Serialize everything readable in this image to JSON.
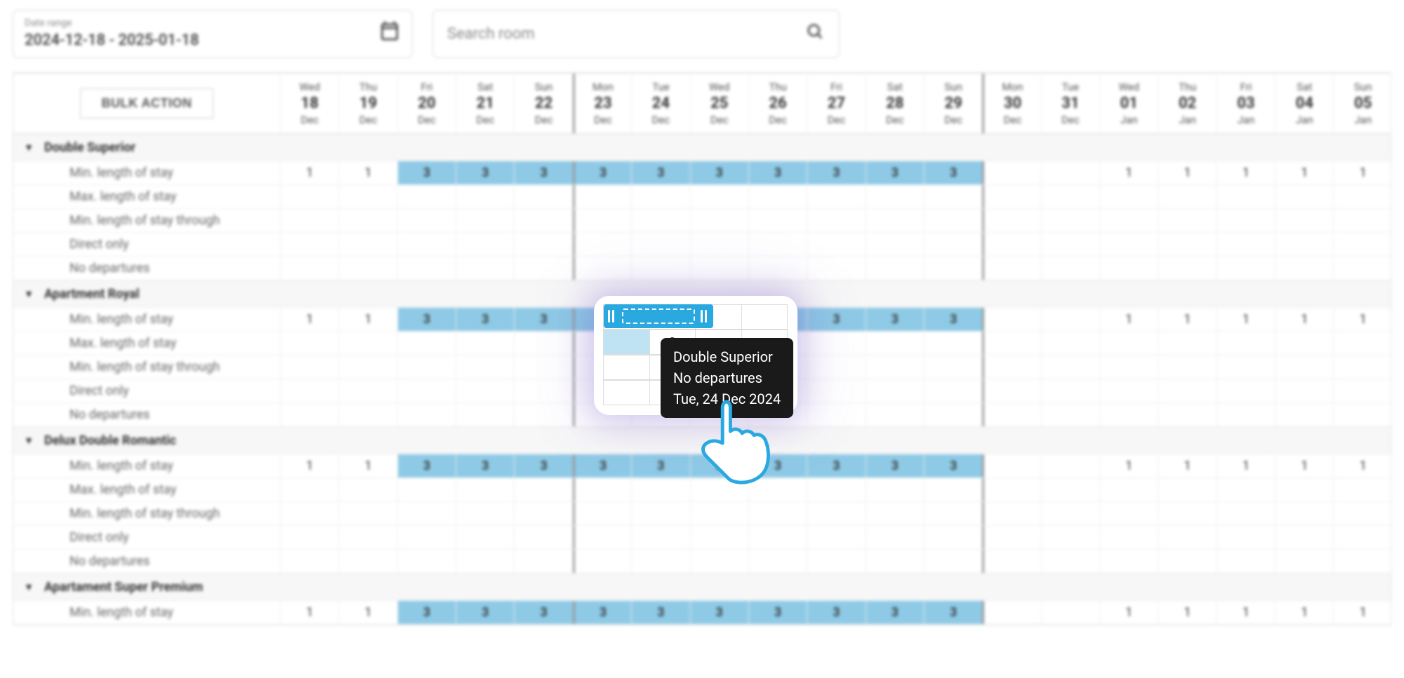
{
  "toolbar": {
    "date_range_label": "Date range",
    "date_range_value": "2024-12-18 - 2025-01-18",
    "search_placeholder": "Search room",
    "bulk_action_label": "BULK ACTION"
  },
  "dates": [
    {
      "dow": "Wed",
      "day": "18",
      "month": "Dec",
      "weeksep": false
    },
    {
      "dow": "Thu",
      "day": "19",
      "month": "Dec",
      "weeksep": false
    },
    {
      "dow": "Fri",
      "day": "20",
      "month": "Dec",
      "weeksep": false
    },
    {
      "dow": "Sat",
      "day": "21",
      "month": "Dec",
      "weeksep": false
    },
    {
      "dow": "Sun",
      "day": "22",
      "month": "Dec",
      "weeksep": false
    },
    {
      "dow": "Mon",
      "day": "23",
      "month": "Dec",
      "weeksep": true
    },
    {
      "dow": "Tue",
      "day": "24",
      "month": "Dec",
      "weeksep": false
    },
    {
      "dow": "Wed",
      "day": "25",
      "month": "Dec",
      "weeksep": false
    },
    {
      "dow": "Thu",
      "day": "26",
      "month": "Dec",
      "weeksep": false
    },
    {
      "dow": "Fri",
      "day": "27",
      "month": "Dec",
      "weeksep": false
    },
    {
      "dow": "Sat",
      "day": "28",
      "month": "Dec",
      "weeksep": false
    },
    {
      "dow": "Sun",
      "day": "29",
      "month": "Dec",
      "weeksep": false
    },
    {
      "dow": "Mon",
      "day": "30",
      "month": "Dec",
      "weeksep": true
    },
    {
      "dow": "Tue",
      "day": "31",
      "month": "Dec",
      "weeksep": false
    },
    {
      "dow": "Wed",
      "day": "01",
      "month": "Jan",
      "weeksep": false
    },
    {
      "dow": "Thu",
      "day": "02",
      "month": "Jan",
      "weeksep": false
    },
    {
      "dow": "Fri",
      "day": "03",
      "month": "Jan",
      "weeksep": false
    },
    {
      "dow": "Sat",
      "day": "04",
      "month": "Jan",
      "weeksep": false
    },
    {
      "dow": "Sun",
      "day": "05",
      "month": "Jan",
      "weeksep": false
    }
  ],
  "prop_labels": {
    "min_stay": "Min. length of stay",
    "max_stay": "Max. length of stay",
    "min_stay_through": "Min. length of stay through",
    "direct_only": "Direct only",
    "no_departures": "No departures"
  },
  "rooms": [
    {
      "name": "Double Superior"
    },
    {
      "name": "Apartment Royal"
    },
    {
      "name": "Delux Double Romantic"
    },
    {
      "name": "Apartament Super Premium"
    }
  ],
  "min_stay_values": [
    {
      "v": "1",
      "hl": false
    },
    {
      "v": "1",
      "hl": false
    },
    {
      "v": "3",
      "hl": true
    },
    {
      "v": "3",
      "hl": true
    },
    {
      "v": "3",
      "hl": true
    },
    {
      "v": "3",
      "hl": true
    },
    {
      "v": "3",
      "hl": true
    },
    {
      "v": "3",
      "hl": true
    },
    {
      "v": "3",
      "hl": true
    },
    {
      "v": "3",
      "hl": true
    },
    {
      "v": "3",
      "hl": true
    },
    {
      "v": "3",
      "hl": true
    },
    {
      "v": "",
      "hl": false
    },
    {
      "v": "",
      "hl": false
    },
    {
      "v": "1",
      "hl": false
    },
    {
      "v": "1",
      "hl": false
    },
    {
      "v": "1",
      "hl": false
    },
    {
      "v": "1",
      "hl": false
    },
    {
      "v": "1",
      "hl": false
    }
  ],
  "tooltip": {
    "line1": "Double Superior",
    "line2": "No departures",
    "line3": "Tue, 24 Dec 2024",
    "secondary_value": "3"
  },
  "colors": {
    "highlight": "#8ecae6",
    "accent": "#2aa9e0"
  }
}
